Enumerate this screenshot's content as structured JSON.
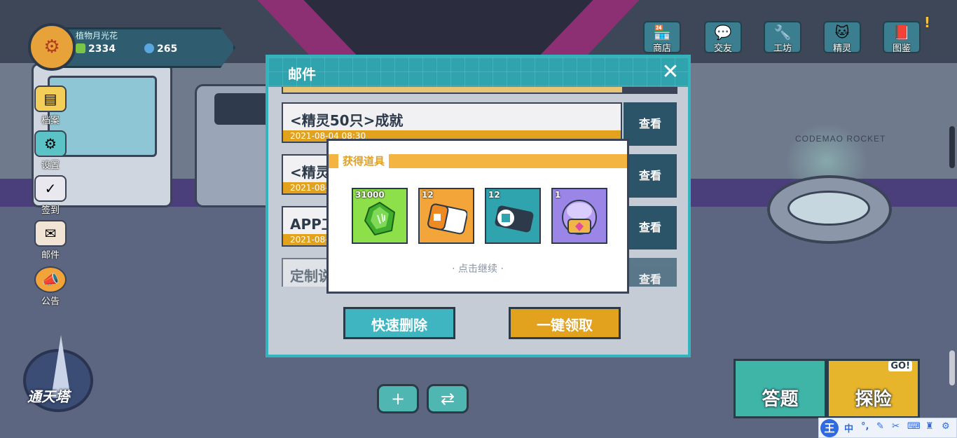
{
  "player": {
    "name": "植物月光花",
    "gems": "2334",
    "crystals": "265",
    "avatar_icon": "robot-avatar"
  },
  "left_menu": [
    {
      "label": "档案",
      "icon": "profile-icon",
      "color": "#f3cf5a"
    },
    {
      "label": "设置",
      "icon": "settings-icon",
      "color": "#5bc3c6"
    },
    {
      "label": "签到",
      "icon": "calendar-icon",
      "color": "#e8e8ee"
    },
    {
      "label": "邮件",
      "icon": "mail-icon",
      "color": "#f1e4d4"
    },
    {
      "label": "公告",
      "icon": "megaphone-icon",
      "color": "#f2a33a"
    }
  ],
  "top_menu": [
    {
      "label": "商店",
      "icon": "shop-icon",
      "glyph": "🏪",
      "alert": ""
    },
    {
      "label": "交友",
      "icon": "chat-icon",
      "glyph": "💬",
      "alert": ""
    },
    {
      "label": "工坊",
      "icon": "tools-icon",
      "glyph": "🔧",
      "alert": ""
    },
    {
      "label": "精灵",
      "icon": "pet-icon",
      "glyph": "🐱",
      "alert": ""
    },
    {
      "label": "图鉴",
      "icon": "book-icon",
      "glyph": "📕",
      "alert": "!"
    }
  ],
  "scene": {
    "rocket_sign": "CODEMAO ROCKET"
  },
  "mail": {
    "title": "邮件",
    "items": [
      {
        "title": "<精灵50只>成就",
        "date": "2021-08-04 08:30",
        "view": "查看"
      },
      {
        "title": "<精灵",
        "date": "2021-08-",
        "view": "查看"
      },
      {
        "title": "APP工",
        "date": "2021-08-",
        "view": "查看"
      },
      {
        "title": "定制说",
        "date": "",
        "view": "查看"
      }
    ],
    "quick_delete": "快速删除",
    "claim_all": "一键领取"
  },
  "reward": {
    "title": "获得道具",
    "items": [
      {
        "count": "31000",
        "name": "green-gem-item",
        "color": "#8ee04a"
      },
      {
        "count": "12",
        "name": "test-ticket-item",
        "color": "#f3a53a"
      },
      {
        "count": "12",
        "name": "block-ticket-item",
        "color": "#2fa4ae"
      },
      {
        "count": "1",
        "name": "mystery-capsule-item",
        "color": "#9b86e8"
      }
    ],
    "continue": "· 点击继续 ·"
  },
  "bottom": {
    "tower_label": "通天塔",
    "quiz_label": "答题",
    "explore_label": "探险",
    "go_badge": "GO!"
  },
  "ime": {
    "logo": "王",
    "mode": "中"
  }
}
